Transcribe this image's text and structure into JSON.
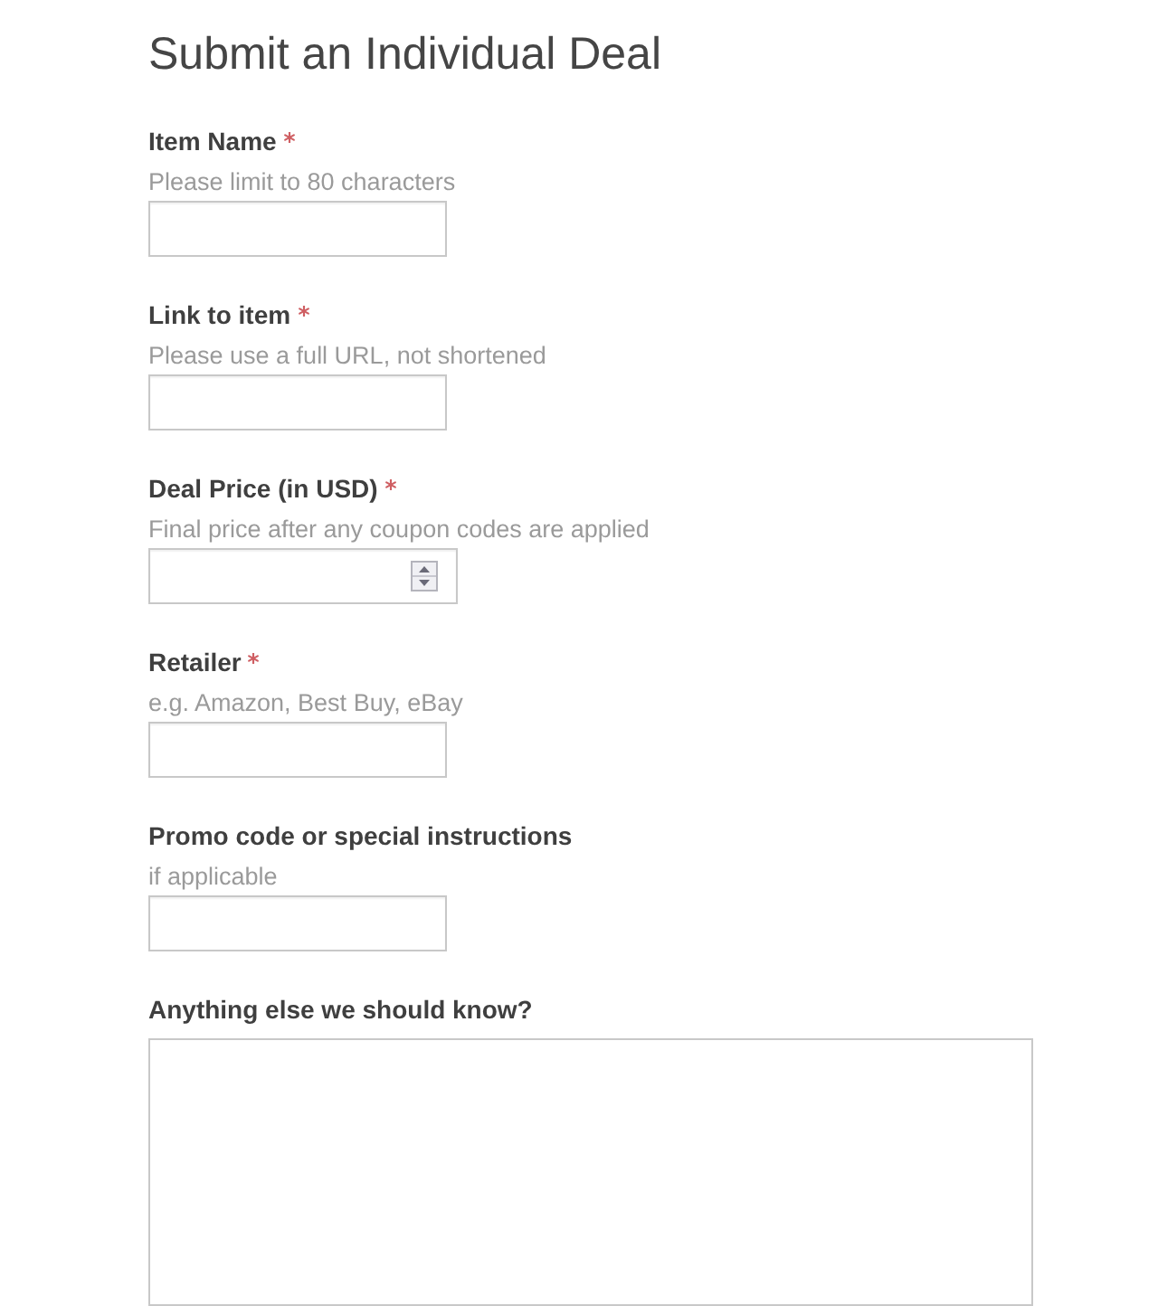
{
  "title": "Submit an Individual Deal",
  "fields": [
    {
      "kind": "text",
      "label": "Item Name",
      "required": true,
      "hint": "Please limit to 80 characters"
    },
    {
      "kind": "text",
      "label": "Link to item",
      "required": true,
      "hint": "Please use a full URL, not shortened"
    },
    {
      "kind": "number",
      "label": "Deal Price (in USD)",
      "required": true,
      "hint": "Final price after any coupon codes are applied"
    },
    {
      "kind": "text",
      "label": "Retailer",
      "required": true,
      "hint": "e.g. Amazon, Best Buy, eBay"
    },
    {
      "kind": "text",
      "label": "Promo code or special instructions",
      "required": false,
      "hint": "if applicable"
    },
    {
      "kind": "textarea",
      "label": "Anything else we should know?",
      "required": false
    }
  ]
}
